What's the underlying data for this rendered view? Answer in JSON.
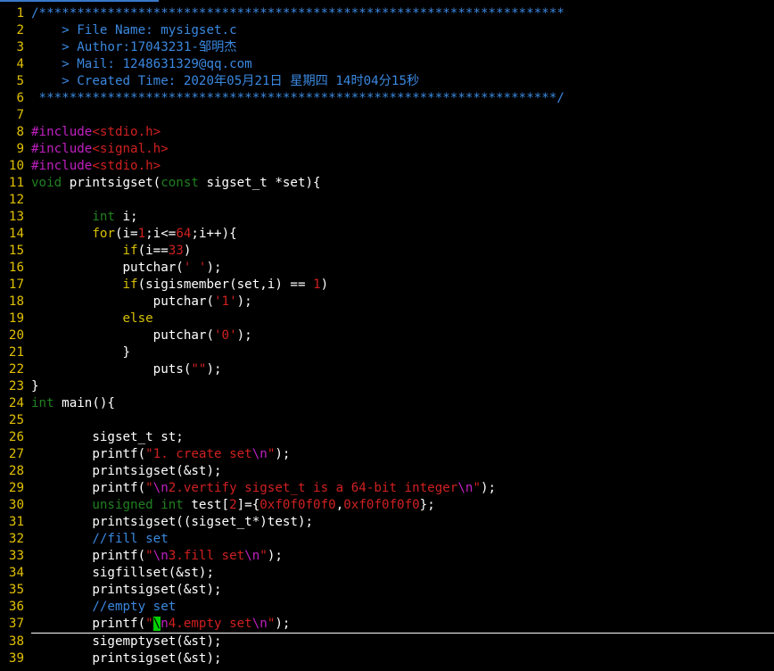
{
  "editor": {
    "cursor_line": 37,
    "colors": {
      "background": "#000000",
      "line_number": "#e0c000",
      "plain": "#ffffff",
      "comment": "#3a88e0",
      "preproc": "#c020c0",
      "type": "#208020",
      "string": "#d02020",
      "number": "#d02020",
      "keyword": "#d8c000",
      "cursor": "#00d000"
    },
    "lines": [
      {
        "n": "1",
        "tokens": [
          {
            "t": "/*********************************************************************",
            "c": "comment"
          }
        ]
      },
      {
        "n": "2",
        "tokens": [
          {
            "t": "    > File Name: mysigset.c",
            "c": "comment"
          }
        ]
      },
      {
        "n": "3",
        "tokens": [
          {
            "t": "    > Author:17043231-邹明杰",
            "c": "comment"
          }
        ]
      },
      {
        "n": "4",
        "tokens": [
          {
            "t": "    > Mail: 1248631329@qq.com",
            "c": "comment"
          }
        ]
      },
      {
        "n": "5",
        "tokens": [
          {
            "t": "    > Created Time: 2020年05月21日 星期四 14时04分15秒",
            "c": "comment"
          }
        ]
      },
      {
        "n": "6",
        "tokens": [
          {
            "t": " ********************************************************************/",
            "c": "comment"
          }
        ]
      },
      {
        "n": "7",
        "tokens": []
      },
      {
        "n": "8",
        "tokens": [
          {
            "t": "#include",
            "c": "preproc"
          },
          {
            "t": "<stdio.h>",
            "c": "string"
          }
        ]
      },
      {
        "n": "9",
        "tokens": [
          {
            "t": "#include",
            "c": "preproc"
          },
          {
            "t": "<signal.h>",
            "c": "string"
          }
        ]
      },
      {
        "n": "10",
        "tokens": [
          {
            "t": "#include",
            "c": "preproc"
          },
          {
            "t": "<stdio.h>",
            "c": "string"
          }
        ]
      },
      {
        "n": "11",
        "tokens": [
          {
            "t": "void",
            "c": "type"
          },
          {
            "t": " printsigset(",
            "c": "plain"
          },
          {
            "t": "const",
            "c": "type"
          },
          {
            "t": " sigset_t *set){",
            "c": "plain"
          }
        ]
      },
      {
        "n": "12",
        "tokens": []
      },
      {
        "n": "13",
        "tokens": [
          {
            "t": "        ",
            "c": "plain"
          },
          {
            "t": "int",
            "c": "type"
          },
          {
            "t": " i;",
            "c": "plain"
          }
        ]
      },
      {
        "n": "14",
        "tokens": [
          {
            "t": "        ",
            "c": "plain"
          },
          {
            "t": "for",
            "c": "keyword"
          },
          {
            "t": "(i=",
            "c": "plain"
          },
          {
            "t": "1",
            "c": "number"
          },
          {
            "t": ";i<=",
            "c": "plain"
          },
          {
            "t": "64",
            "c": "number"
          },
          {
            "t": ";i++){",
            "c": "plain"
          }
        ]
      },
      {
        "n": "15",
        "tokens": [
          {
            "t": "            ",
            "c": "plain"
          },
          {
            "t": "if",
            "c": "keyword"
          },
          {
            "t": "(i==",
            "c": "plain"
          },
          {
            "t": "33",
            "c": "number"
          },
          {
            "t": ")",
            "c": "plain"
          }
        ]
      },
      {
        "n": "16",
        "tokens": [
          {
            "t": "            putchar(",
            "c": "plain"
          },
          {
            "t": "' '",
            "c": "string"
          },
          {
            "t": ");",
            "c": "plain"
          }
        ]
      },
      {
        "n": "17",
        "tokens": [
          {
            "t": "            ",
            "c": "plain"
          },
          {
            "t": "if",
            "c": "keyword"
          },
          {
            "t": "(sigismember(set,i) == ",
            "c": "plain"
          },
          {
            "t": "1",
            "c": "number"
          },
          {
            "t": ")",
            "c": "plain"
          }
        ]
      },
      {
        "n": "18",
        "tokens": [
          {
            "t": "                putchar(",
            "c": "plain"
          },
          {
            "t": "'1'",
            "c": "string"
          },
          {
            "t": ");",
            "c": "plain"
          }
        ]
      },
      {
        "n": "19",
        "tokens": [
          {
            "t": "            ",
            "c": "plain"
          },
          {
            "t": "else",
            "c": "keyword"
          }
        ]
      },
      {
        "n": "20",
        "tokens": [
          {
            "t": "                putchar(",
            "c": "plain"
          },
          {
            "t": "'0'",
            "c": "string"
          },
          {
            "t": ");",
            "c": "plain"
          }
        ]
      },
      {
        "n": "21",
        "tokens": [
          {
            "t": "            }",
            "c": "plain"
          }
        ]
      },
      {
        "n": "22",
        "tokens": [
          {
            "t": "                puts(",
            "c": "plain"
          },
          {
            "t": "\"\"",
            "c": "string"
          },
          {
            "t": ");",
            "c": "plain"
          }
        ]
      },
      {
        "n": "23",
        "tokens": [
          {
            "t": "}",
            "c": "plain"
          }
        ]
      },
      {
        "n": "24",
        "tokens": [
          {
            "t": "int",
            "c": "type"
          },
          {
            "t": " main(){",
            "c": "plain"
          }
        ]
      },
      {
        "n": "25",
        "tokens": []
      },
      {
        "n": "26",
        "tokens": [
          {
            "t": "        sigset_t st;",
            "c": "plain"
          }
        ]
      },
      {
        "n": "27",
        "tokens": [
          {
            "t": "        printf(",
            "c": "plain"
          },
          {
            "t": "\"1. create set",
            "c": "string"
          },
          {
            "t": "\\n",
            "c": "preproc"
          },
          {
            "t": "\"",
            "c": "string"
          },
          {
            "t": ");",
            "c": "plain"
          }
        ]
      },
      {
        "n": "28",
        "tokens": [
          {
            "t": "        printsigset(&st);",
            "c": "plain"
          }
        ]
      },
      {
        "n": "29",
        "tokens": [
          {
            "t": "        printf(",
            "c": "plain"
          },
          {
            "t": "\"",
            "c": "string"
          },
          {
            "t": "\\n",
            "c": "preproc"
          },
          {
            "t": "2.vertify sigset_t is a 64-bit integer",
            "c": "string"
          },
          {
            "t": "\\n",
            "c": "preproc"
          },
          {
            "t": "\"",
            "c": "string"
          },
          {
            "t": ");",
            "c": "plain"
          }
        ]
      },
      {
        "n": "30",
        "tokens": [
          {
            "t": "        ",
            "c": "plain"
          },
          {
            "t": "unsigned int",
            "c": "type"
          },
          {
            "t": " test[",
            "c": "plain"
          },
          {
            "t": "2",
            "c": "number"
          },
          {
            "t": "]={",
            "c": "plain"
          },
          {
            "t": "0xf0f0f0f0",
            "c": "number"
          },
          {
            "t": ",",
            "c": "plain"
          },
          {
            "t": "0xf0f0f0f0",
            "c": "number"
          },
          {
            "t": "};",
            "c": "plain"
          }
        ]
      },
      {
        "n": "31",
        "tokens": [
          {
            "t": "        printsigset((sigset_t*)test);",
            "c": "plain"
          }
        ]
      },
      {
        "n": "32",
        "tokens": [
          {
            "t": "        ",
            "c": "plain"
          },
          {
            "t": "//fill set",
            "c": "comment"
          }
        ]
      },
      {
        "n": "33",
        "tokens": [
          {
            "t": "        printf(",
            "c": "plain"
          },
          {
            "t": "\"",
            "c": "string"
          },
          {
            "t": "\\n",
            "c": "preproc"
          },
          {
            "t": "3.fill set",
            "c": "string"
          },
          {
            "t": "\\n",
            "c": "preproc"
          },
          {
            "t": "\"",
            "c": "string"
          },
          {
            "t": ");",
            "c": "plain"
          }
        ]
      },
      {
        "n": "34",
        "tokens": [
          {
            "t": "        sigfillset(&st);",
            "c": "plain"
          }
        ]
      },
      {
        "n": "35",
        "tokens": [
          {
            "t": "        printsigset(&st);",
            "c": "plain"
          }
        ]
      },
      {
        "n": "36",
        "tokens": [
          {
            "t": "        ",
            "c": "plain"
          },
          {
            "t": "//empty set",
            "c": "comment"
          }
        ]
      },
      {
        "n": "37",
        "tokens": [
          {
            "t": "        printf(",
            "c": "plain"
          },
          {
            "t": "\"",
            "c": "string"
          },
          {
            "t": "\\",
            "c": "cursor"
          },
          {
            "t": "n",
            "c": "preproc"
          },
          {
            "t": "4.empty set",
            "c": "string"
          },
          {
            "t": "\\n",
            "c": "preproc"
          },
          {
            "t": "\"",
            "c": "string"
          },
          {
            "t": ");",
            "c": "plain"
          }
        ]
      },
      {
        "n": "38",
        "tokens": [
          {
            "t": "        sigemptyset(&st);",
            "c": "plain"
          }
        ]
      },
      {
        "n": "39",
        "tokens": [
          {
            "t": "        printsigset(&st);",
            "c": "plain"
          }
        ]
      }
    ]
  }
}
